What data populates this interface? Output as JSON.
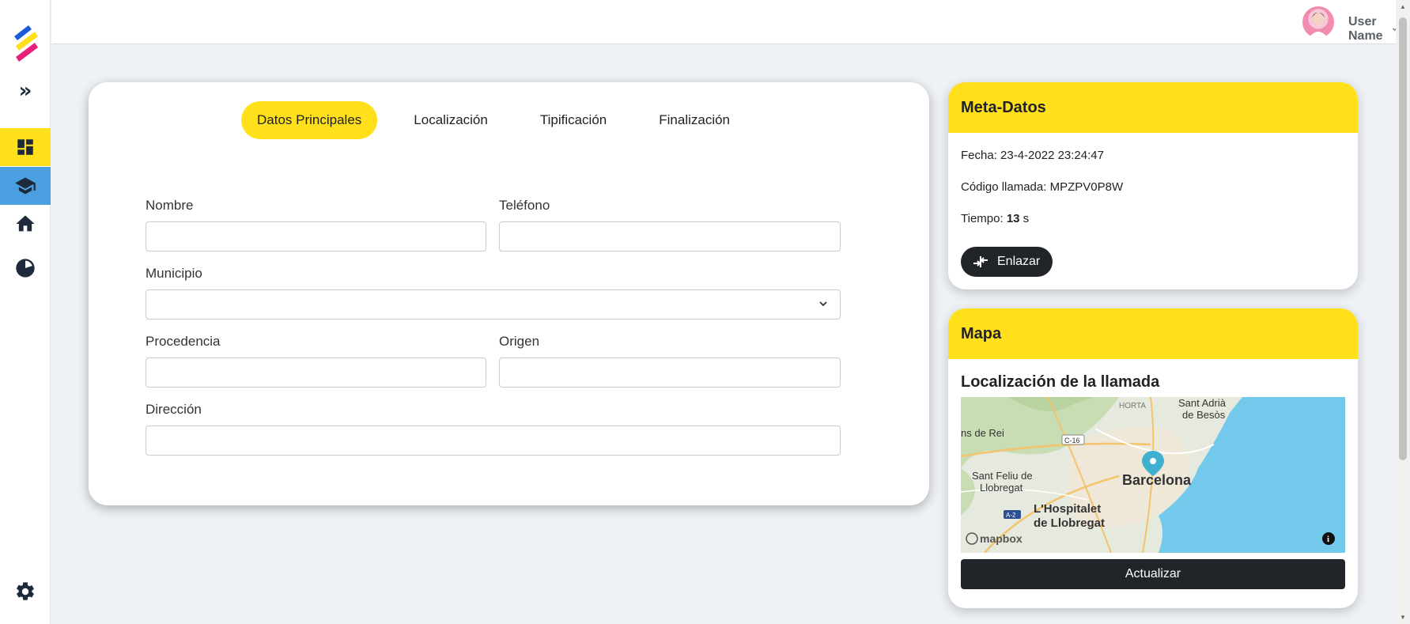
{
  "sidebar": {
    "expand_glyph": "»",
    "items": [
      {
        "name": "dashboard",
        "icon": "dashboard-icon",
        "active": true
      },
      {
        "name": "school",
        "icon": "graduation-cap-icon"
      },
      {
        "name": "home",
        "icon": "home-icon"
      },
      {
        "name": "stats",
        "icon": "pie-chart-icon"
      }
    ],
    "settings_icon": "gear-icon"
  },
  "topbar": {
    "user_name": "User Name"
  },
  "tabs": [
    {
      "label": "Datos Principales",
      "active": true
    },
    {
      "label": "Localización"
    },
    {
      "label": "Tipificación"
    },
    {
      "label": "Finalización"
    }
  ],
  "form": {
    "nombre_label": "Nombre",
    "nombre_value": "",
    "telefono_label": "Teléfono",
    "telefono_value": "",
    "municipio_label": "Municipio",
    "municipio_value": "",
    "procedencia_label": "Procedencia",
    "procedencia_value": "",
    "origen_label": "Origen",
    "origen_value": "",
    "direccion_label": "Dirección",
    "direccion_value": ""
  },
  "meta": {
    "title": "Meta-Datos",
    "fecha_label": "Fecha:",
    "fecha_value": "23-4-2022 23:24:47",
    "codigo_label": "Código llamada:",
    "codigo_value": "MPZPV0P8W",
    "tiempo_label": "Tiempo:",
    "tiempo_value": "13",
    "tiempo_unit": "s",
    "link_button": "Enlazar"
  },
  "map_card": {
    "title": "Mapa",
    "subtitle": "Localización de la llamada",
    "labels": {
      "horta": "HORTA",
      "sant_adria_1": "Sant Adrià",
      "sant_adria_2": "de Besòs",
      "ns_de_rei": "ns de Rei",
      "c16": "C-16",
      "sant_feliu_1": "Sant Feliu de",
      "sant_feliu_2": "Llobregat",
      "barcelona": "Barcelona",
      "hospitalet_1": "L'Hospitalet",
      "hospitalet_2": "de Llobregat",
      "a2": "A-2",
      "mapbox": "mapbox"
    },
    "update_button": "Actualizar"
  },
  "colors": {
    "accent": "#ffe01b",
    "active_blue": "#4a9fe0",
    "dark": "#212529",
    "sea": "#73c9ec"
  }
}
